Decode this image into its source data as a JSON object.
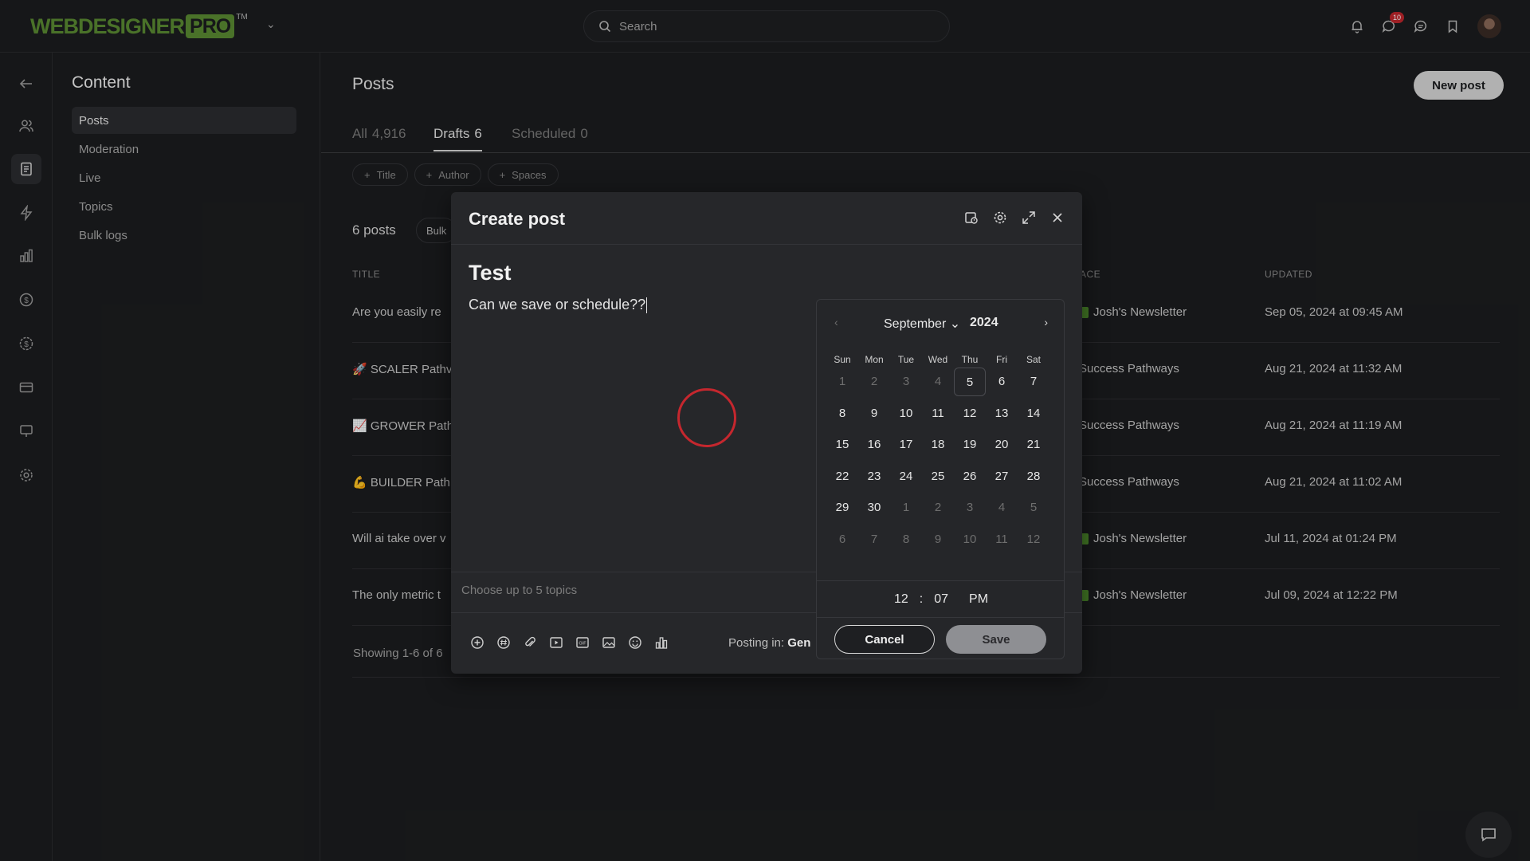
{
  "app": {
    "logo_web": "WEBDESIGNER",
    "logo_pro": "PRO",
    "logo_tm": "TM",
    "search_placeholder": "Search",
    "notification_badge": "10"
  },
  "sidebar": {
    "title": "Content",
    "items": [
      {
        "label": "Posts",
        "active": true
      },
      {
        "label": "Moderation"
      },
      {
        "label": "Live"
      },
      {
        "label": "Topics"
      },
      {
        "label": "Bulk logs"
      }
    ]
  },
  "main": {
    "title": "Posts",
    "new_post_label": "New post",
    "tabs": [
      {
        "label": "All",
        "count": "4,916"
      },
      {
        "label": "Drafts",
        "count": "6",
        "active": true
      },
      {
        "label": "Scheduled",
        "count": "0"
      }
    ],
    "filters": [
      "Title",
      "Author",
      "Spaces"
    ],
    "post_count": "6 posts",
    "bulk_label": "Bulk",
    "columns": {
      "title": "TITLE",
      "space": "ACE",
      "updated": "UPDATED"
    },
    "rows": [
      {
        "title": "Are you easily re",
        "space": "Josh's Newsletter",
        "updated": "Sep 05, 2024 at 09:45 AM",
        "space_icon": true
      },
      {
        "title": "🚀 SCALER Pathv",
        "space": "Success Pathways",
        "updated": "Aug 21, 2024 at 11:32 AM"
      },
      {
        "title": "📈 GROWER Path",
        "space": "Success Pathways",
        "updated": "Aug 21, 2024 at 11:19 AM"
      },
      {
        "title": "💪 BUILDER Path",
        "space": "Success Pathways",
        "updated": "Aug 21, 2024 at 11:02 AM"
      },
      {
        "title": "Will ai take over v",
        "space": "Josh's Newsletter",
        "updated": "Jul 11, 2024 at 01:24 PM",
        "space_icon": true
      },
      {
        "title": "The only metric t",
        "space": "Josh's Newsletter",
        "updated": "Jul 09, 2024 at 12:22 PM",
        "space_icon": true
      }
    ],
    "showing": "Showing 1-6 of 6"
  },
  "modal": {
    "title": "Create post",
    "post_title": "Test",
    "post_body": "Can we save or schedule??",
    "topics_placeholder": "Choose up to 5 topics",
    "posting_in_label": "Posting in:",
    "posting_in_value": "Gen"
  },
  "picker": {
    "month": "September",
    "year": "2024",
    "weekdays": [
      "Sun",
      "Mon",
      "Tue",
      "Wed",
      "Thu",
      "Fri",
      "Sat"
    ],
    "days": [
      [
        "1",
        "2",
        "3",
        "4",
        "5",
        "6",
        "7"
      ],
      [
        "8",
        "9",
        "10",
        "11",
        "12",
        "13",
        "14"
      ],
      [
        "15",
        "16",
        "17",
        "18",
        "19",
        "20",
        "21"
      ],
      [
        "22",
        "23",
        "24",
        "25",
        "26",
        "27",
        "28"
      ],
      [
        "29",
        "30",
        "1",
        "2",
        "3",
        "4",
        "5"
      ],
      [
        "6",
        "7",
        "8",
        "9",
        "10",
        "11",
        "12"
      ]
    ],
    "muted_first_row_before": 5,
    "today": "5",
    "hour": "12",
    "minute": "07",
    "ampm": "PM",
    "cancel_label": "Cancel",
    "save_label": "Save"
  },
  "colors": {
    "brand_green": "#5b8c32",
    "badge_red": "#c0262d",
    "spinner_red": "#c5272e"
  }
}
